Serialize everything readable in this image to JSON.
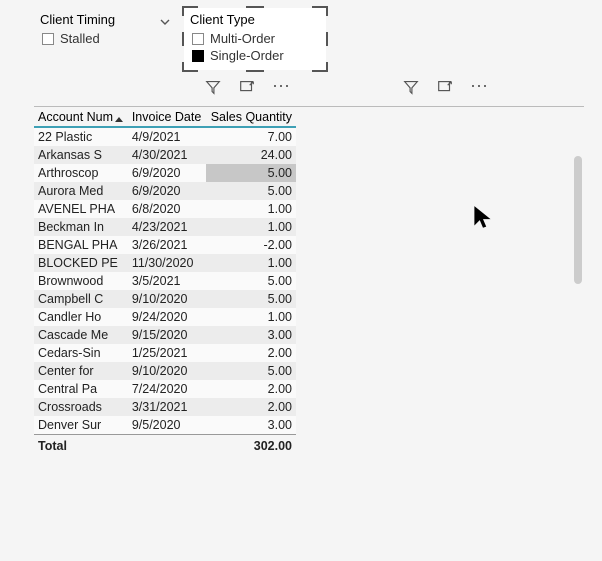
{
  "slicers": {
    "timing": {
      "title": "Client Timing",
      "items": [
        "Stalled"
      ]
    },
    "type": {
      "title": "Client Type",
      "items": [
        "Multi-Order",
        "Single-Order"
      ]
    }
  },
  "table": {
    "columns": [
      "Account Num",
      "Invoice Date",
      "Sales Quantity"
    ],
    "rows": [
      {
        "acct": "22 Plastic",
        "date": "4/9/2021",
        "qty": "7.00"
      },
      {
        "acct": "Arkansas S",
        "date": "4/30/2021",
        "qty": "24.00"
      },
      {
        "acct": "Arthroscop",
        "date": "6/9/2020",
        "qty": "5.00",
        "hl_qty": true
      },
      {
        "acct": "Aurora Med",
        "date": "6/9/2020",
        "qty": "5.00"
      },
      {
        "acct": "AVENEL PHA",
        "date": "6/8/2020",
        "qty": "1.00"
      },
      {
        "acct": "Beckman In",
        "date": "4/23/2021",
        "qty": "1.00"
      },
      {
        "acct": "BENGAL PHA",
        "date": "3/26/2021",
        "qty": "-2.00"
      },
      {
        "acct": "BLOCKED PE",
        "date": "11/30/2020",
        "qty": "1.00"
      },
      {
        "acct": "Brownwood",
        "date": "3/5/2021",
        "qty": "5.00"
      },
      {
        "acct": "Campbell C",
        "date": "9/10/2020",
        "qty": "5.00"
      },
      {
        "acct": "Candler Ho",
        "date": "9/24/2020",
        "qty": "1.00"
      },
      {
        "acct": "Cascade Me",
        "date": "9/15/2020",
        "qty": "3.00"
      },
      {
        "acct": "Cedars-Sin",
        "date": "1/25/2021",
        "qty": "2.00"
      },
      {
        "acct": "Center for",
        "date": "9/10/2020",
        "qty": "5.00"
      },
      {
        "acct": "Central Pa",
        "date": "7/24/2020",
        "qty": "2.00"
      },
      {
        "acct": "Crossroads",
        "date": "3/31/2021",
        "qty": "2.00"
      },
      {
        "acct": "Denver Sur",
        "date": "9/5/2020",
        "qty": "3.00"
      }
    ],
    "total_label": "Total",
    "total_value": "302.00"
  }
}
